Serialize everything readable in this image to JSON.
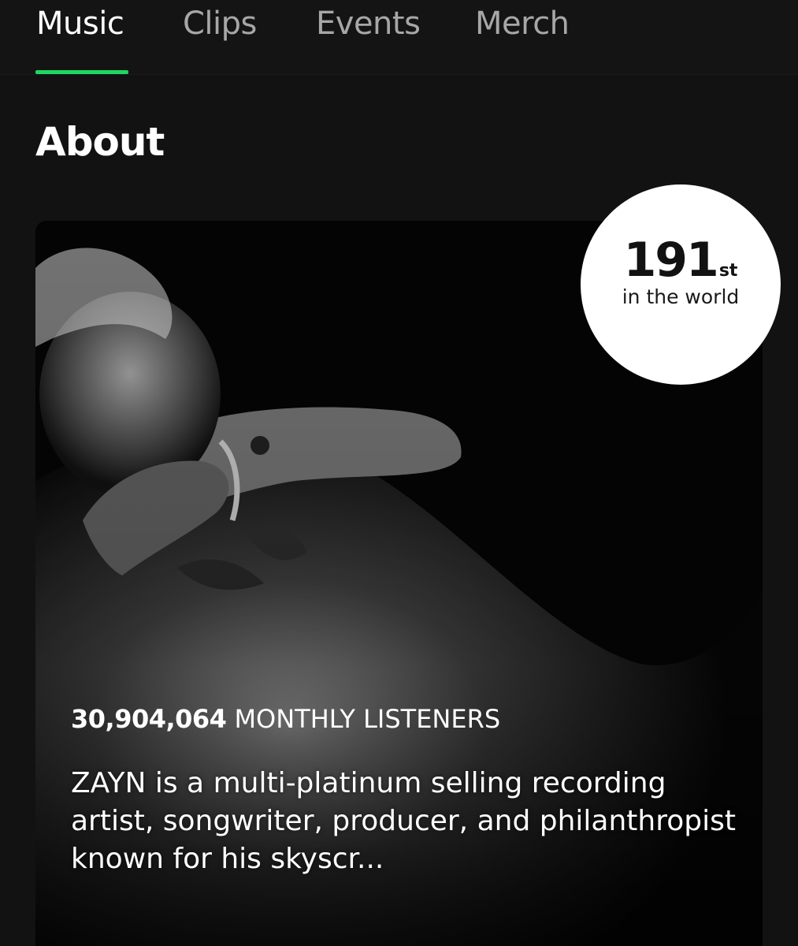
{
  "tabs": [
    {
      "label": "Music",
      "active": true
    },
    {
      "label": "Clips",
      "active": false
    },
    {
      "label": "Events",
      "active": false
    },
    {
      "label": "Merch",
      "active": false
    }
  ],
  "accent_color": "#1ed760",
  "about": {
    "title": "About",
    "rank": {
      "number": "191",
      "suffix": "st",
      "label": "in the world"
    },
    "monthly_listeners": {
      "count": "30,904,064",
      "label": "MONTHLY LISTENERS"
    },
    "bio": "ZAYN is a multi-platinum selling recording artist, songwriter, producer, and philanthropist known for his skyscr..."
  }
}
